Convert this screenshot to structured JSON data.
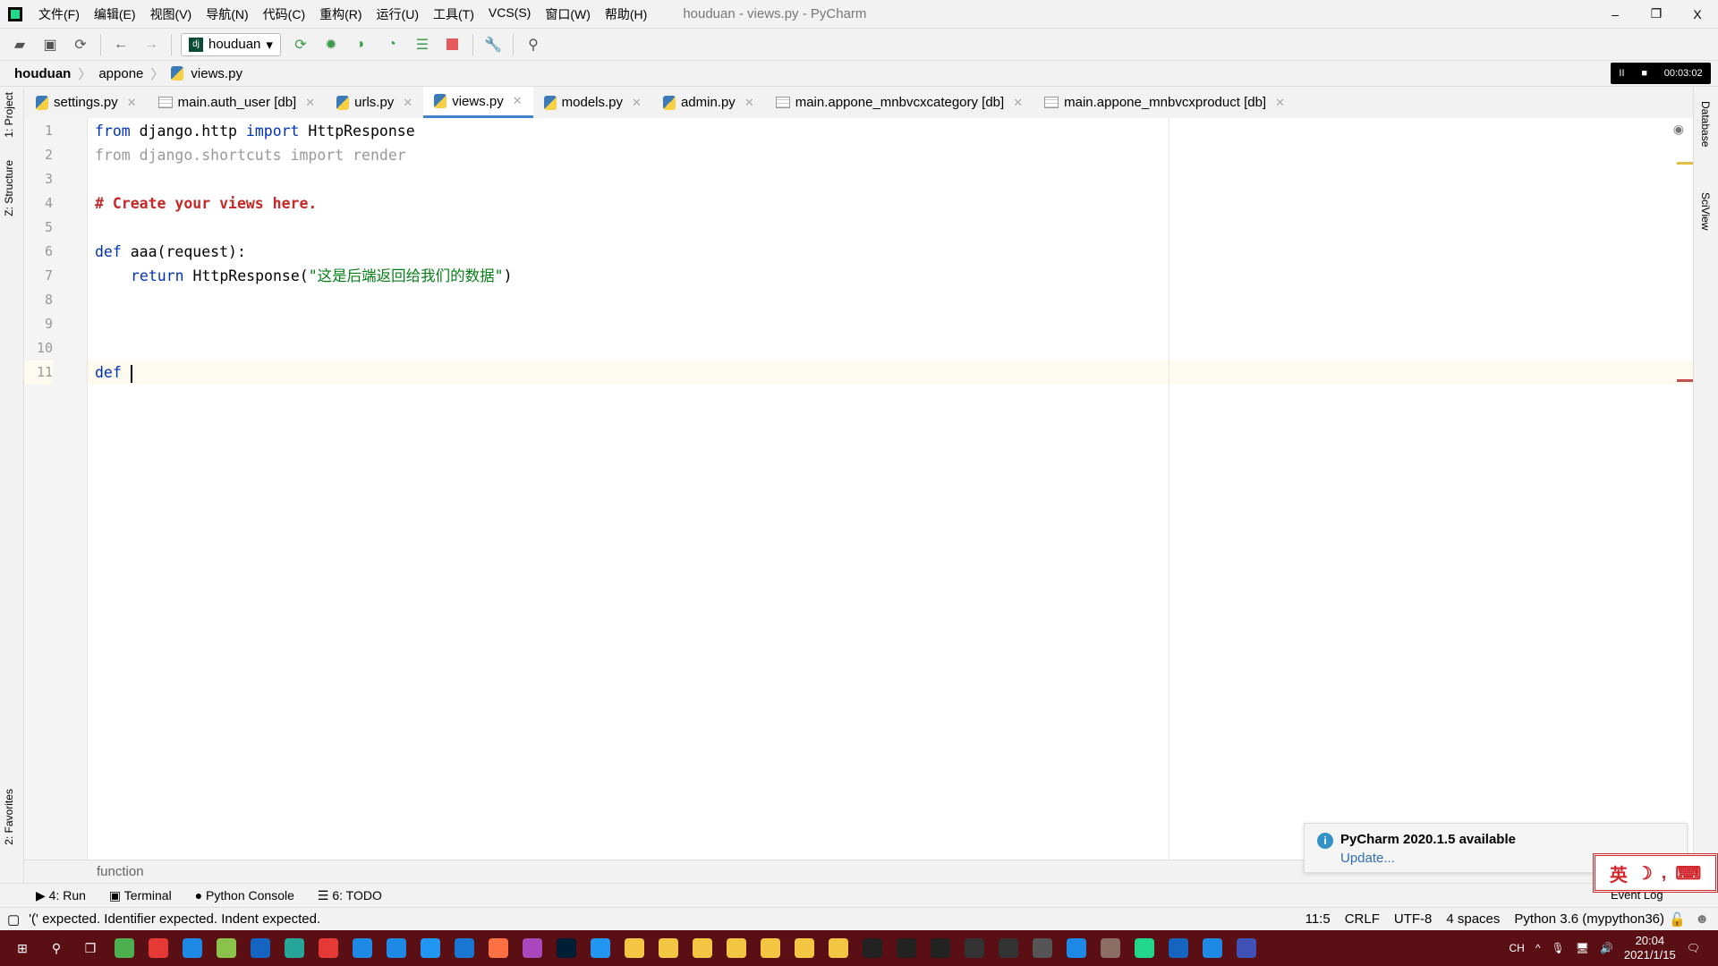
{
  "window": {
    "title": "houduan - views.py - PyCharm",
    "minimize": "–",
    "restore": "❐",
    "close": "X"
  },
  "menu": [
    "文件(F)",
    "编辑(E)",
    "视图(V)",
    "导航(N)",
    "代码(C)",
    "重构(R)",
    "运行(U)",
    "工具(T)",
    "VCS(S)",
    "窗口(W)",
    "帮助(H)"
  ],
  "toolbar": {
    "run_config": "houduan",
    "icons": [
      "open-icon",
      "save-icon",
      "sync-icon",
      "back-icon",
      "forward-icon",
      "run-icon",
      "debug-icon",
      "coverage-icon",
      "profile-icon",
      "concurrency-icon",
      "stop-icon",
      "wrench-icon",
      "search-icon"
    ]
  },
  "breadcrumb": [
    "houduan",
    "appone",
    "views.py"
  ],
  "recorder": {
    "pause": "II",
    "stop": "■",
    "time": "00:03:02"
  },
  "tabs": [
    {
      "label": "settings.py",
      "type": "py"
    },
    {
      "label": "main.auth_user [db]",
      "type": "db"
    },
    {
      "label": "urls.py",
      "type": "py"
    },
    {
      "label": "views.py",
      "type": "py",
      "active": true
    },
    {
      "label": "models.py",
      "type": "py"
    },
    {
      "label": "admin.py",
      "type": "py"
    },
    {
      "label": "main.appone_mnbvcxcategory [db]",
      "type": "db"
    },
    {
      "label": "main.appone_mnbvcxproduct [db]",
      "type": "db"
    }
  ],
  "left_tools": [
    "1: Project",
    "Z: Structure",
    "2: Favorites"
  ],
  "right_tools": [
    "Database",
    "SciView"
  ],
  "code": {
    "line_numbers": [
      "1",
      "2",
      "3",
      "4",
      "5",
      "6",
      "7",
      "8",
      "9",
      "10",
      "11"
    ],
    "l1": {
      "kw1": "from",
      "a": " django.http ",
      "kw2": "import",
      "b": " HttpResponse"
    },
    "l2": "from django.shortcuts import render",
    "l4": "# Create your views here.",
    "l6": {
      "kw": "def",
      "rest": " aaa(request):"
    },
    "l7": {
      "kw": "return",
      "a": " HttpResponse(",
      "str": "\"这是后端返回给我们的数据\"",
      "b": ")"
    },
    "l11": {
      "kw": "def",
      "rest": " "
    }
  },
  "hint": "function",
  "tool_windows": [
    "4: Run",
    "Terminal",
    "Python Console",
    "6: TODO"
  ],
  "status": {
    "message": "'(' expected. Identifier expected. Indent expected.",
    "position": "11:5",
    "line_sep": "CRLF",
    "encoding": "UTF-8",
    "indent": "4 spaces",
    "interpreter": "Python 3.6 (mypython36)"
  },
  "notification": {
    "title": "PyCharm 2020.1.5 available",
    "link": "Update...",
    "event_log": "Event Log"
  },
  "ime": {
    "label": "英"
  },
  "taskbar": {
    "ch": "CH",
    "time": "20:04",
    "date": "2021/1/15",
    "app_colors": [
      "#4caf50",
      "#e53935",
      "#1e88e5",
      "#8bc34a",
      "#1565c0",
      "#26a69a",
      "#e53935",
      "#1e88e5",
      "#1e88e5",
      "#2196f3",
      "#1976d2",
      "#ff7043",
      "#ab47bc",
      "#001e36",
      "#2196f3",
      "#f4c542",
      "#f4c542",
      "#f4c542",
      "#f4c542",
      "#f4c542",
      "#f4c542",
      "#f4c542",
      "#222",
      "#222",
      "#222",
      "#333",
      "#333",
      "#555",
      "#1e88e5",
      "#8d6e63",
      "#21d789",
      "#1565c0",
      "#1e88e5",
      "#3f51b5"
    ]
  }
}
